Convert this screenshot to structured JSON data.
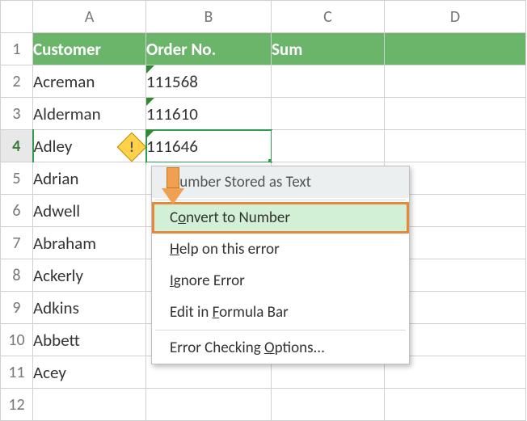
{
  "columns": [
    "A",
    "B",
    "C",
    "D"
  ],
  "hdr": {
    "A": "Customer",
    "B": "Order No.",
    "C": "Sum"
  },
  "rows": [
    {
      "n": "1"
    },
    {
      "n": "2",
      "A": "Acreman",
      "B": "111568"
    },
    {
      "n": "3",
      "A": "Alderman",
      "B": "111610"
    },
    {
      "n": "4",
      "A": "Adley",
      "B": "111646"
    },
    {
      "n": "5",
      "A": "Adrian"
    },
    {
      "n": "6",
      "A": "Adwell"
    },
    {
      "n": "7",
      "A": "Abraham"
    },
    {
      "n": "8",
      "A": "Ackerly"
    },
    {
      "n": "9",
      "A": "Adkins"
    },
    {
      "n": "10",
      "A": "Abbett"
    },
    {
      "n": "11",
      "A": "Acey"
    },
    {
      "n": "12"
    }
  ],
  "menu": {
    "header": "Number Stored as Text",
    "convert_pre": "C",
    "convert_mn": "o",
    "convert_post": "nvert to Number",
    "help_pre": "",
    "help_mn": "H",
    "help_post": "elp on this error",
    "ignore_pre": "",
    "ignore_mn": "I",
    "ignore_post": "gnore Error",
    "formula_pre": "Edit in ",
    "formula_mn": "F",
    "formula_post": "ormula Bar",
    "options_pre": "Error Checking ",
    "options_mn": "O",
    "options_post": "ptions..."
  },
  "error_glyph": "!"
}
